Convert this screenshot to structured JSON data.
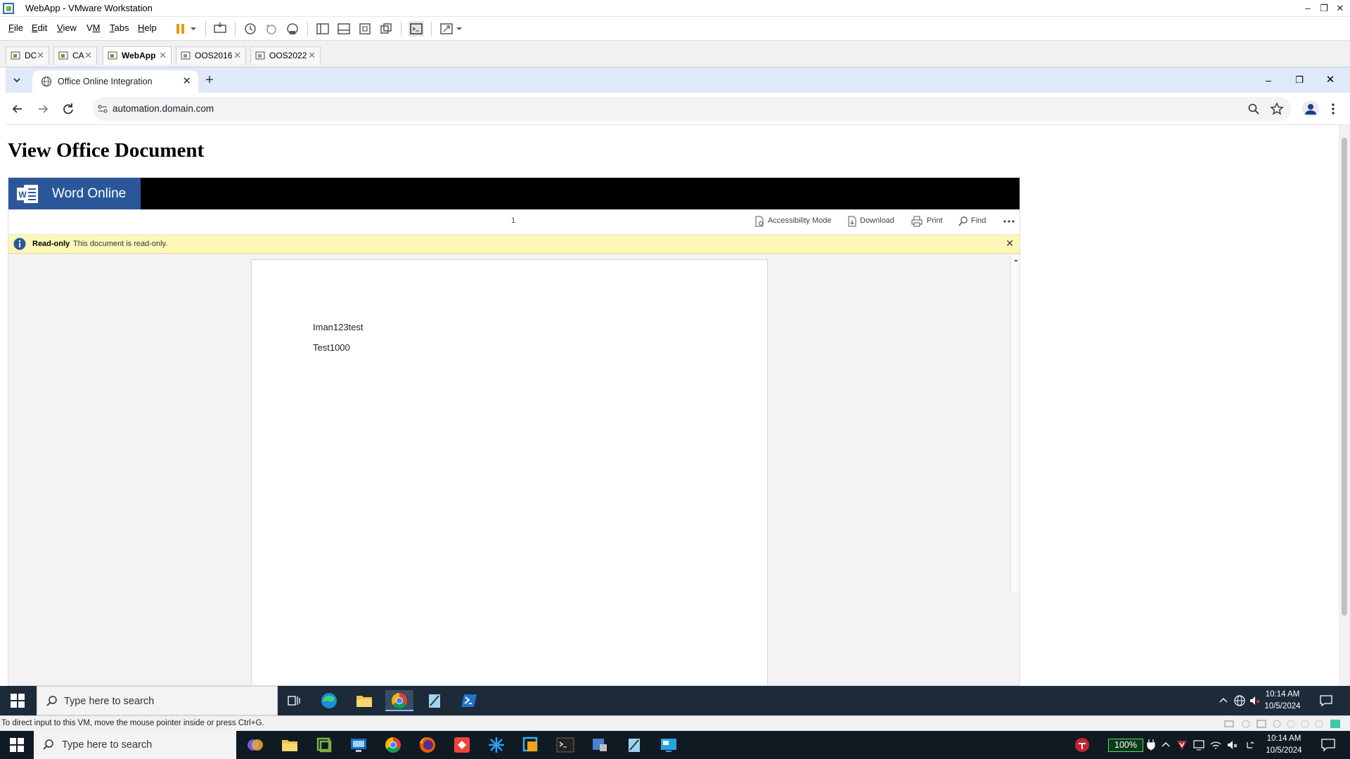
{
  "vmware": {
    "window_title": "WebApp - VMware Workstation",
    "menu": [
      {
        "pre": "",
        "u": "F",
        "post": "ile"
      },
      {
        "pre": "",
        "u": "E",
        "post": "dit"
      },
      {
        "pre": "",
        "u": "V",
        "post": "iew"
      },
      {
        "pre": "V",
        "u": "M",
        "post": ""
      },
      {
        "pre": "",
        "u": "T",
        "post": "abs"
      },
      {
        "pre": "",
        "u": "H",
        "post": "elp"
      }
    ],
    "tabs": [
      {
        "label": "DC",
        "active": false
      },
      {
        "label": "CA",
        "active": false
      },
      {
        "label": "WebApp",
        "active": true
      },
      {
        "label": "OOS2016",
        "active": false
      },
      {
        "label": "OOS2022",
        "active": false
      }
    ],
    "status_message": "To direct input to this VM, move the mouse pointer inside or press Ctrl+G.",
    "accent_color": "#2b579a"
  },
  "browser": {
    "tab_title": "Office Online Integration",
    "url": "automation.domain.com"
  },
  "page": {
    "heading": "View Office Document"
  },
  "word_viewer": {
    "app_name": "Word Online",
    "page_number": "1",
    "commands": {
      "accessibility": "Accessibility Mode",
      "download": "Download",
      "print": "Print",
      "find": "Find"
    },
    "info_bar": {
      "title": "Read-only",
      "message": "This document is read-only."
    },
    "document_lines": [
      "Iman123test",
      "Test1000"
    ]
  },
  "guest_taskbar": {
    "search_placeholder": "Type here to search",
    "time": "10:14 AM",
    "date": "10/5/2024"
  },
  "host_taskbar": {
    "search_placeholder": "Type here to search",
    "battery": "100%",
    "time": "10:14 AM",
    "date": "10/5/2024"
  }
}
